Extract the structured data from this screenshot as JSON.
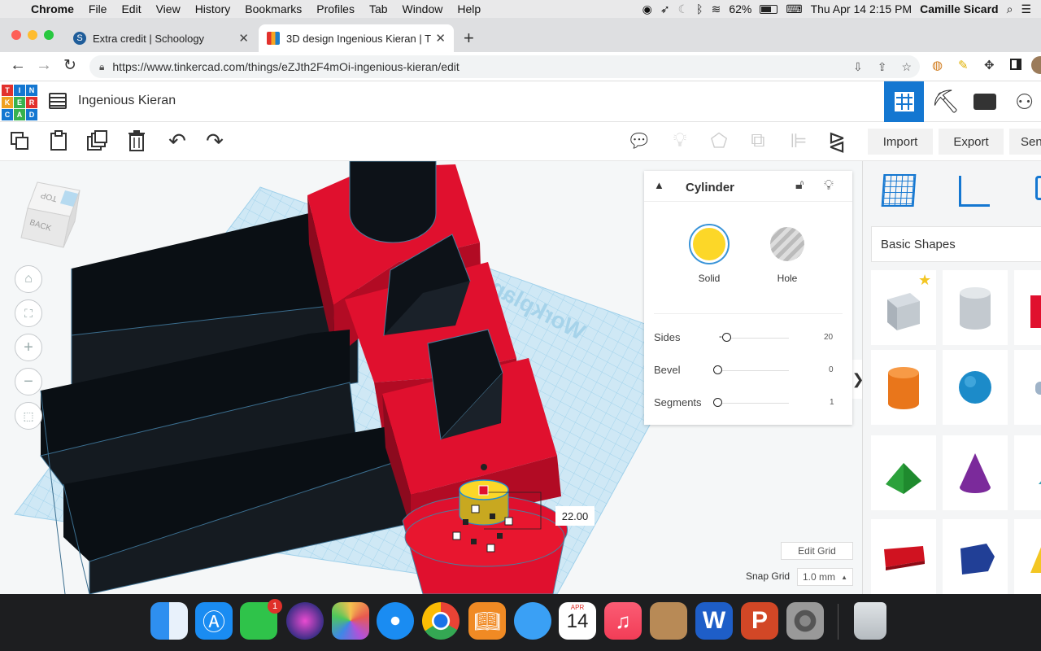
{
  "menubar": {
    "app": "Chrome",
    "items": [
      "File",
      "Edit",
      "View",
      "History",
      "Bookmarks",
      "Profiles",
      "Tab",
      "Window",
      "Help"
    ],
    "battery": "62%",
    "clock": "Thu Apr 14  2:15 PM",
    "user": "Camille Sicard"
  },
  "tabs": [
    {
      "title": "Extra credit | Schoology",
      "favicon": "S"
    },
    {
      "title": "3D design Ingenious Kieran | T",
      "favicon": "grid"
    }
  ],
  "url": "https://www.tinkercad.com/things/eZJth2F4mOi-ingenious-kieran/edit",
  "tinkercad": {
    "logo": [
      "T",
      "I",
      "N",
      "K",
      "E",
      "R",
      "C",
      "A",
      "D"
    ],
    "design_name": "Ingenious Kieran",
    "import_label": "Import",
    "export_label": "Export",
    "send_label": "Sen"
  },
  "viewcube": {
    "top": "TOP",
    "back": "BACK"
  },
  "inspector": {
    "title": "Cylinder",
    "solid_label": "Solid",
    "hole_label": "Hole",
    "params": [
      {
        "label": "Sides",
        "value": "20",
        "fraction": 0.12
      },
      {
        "label": "Bevel",
        "value": "0",
        "fraction": 0.0
      },
      {
        "label": "Segments",
        "value": "1",
        "fraction": 0.0
      }
    ]
  },
  "dimension_label": "22.00",
  "workplane_label": "Workplane",
  "edit_grid_label": "Edit Grid",
  "snap_grid_label": "Snap Grid",
  "snap_grid_value": "1.0 mm",
  "right_panel": {
    "category": "Basic Shapes"
  },
  "dock": {
    "facetime_badge": "1",
    "calendar_month": "APR",
    "calendar_day": "14"
  },
  "colors": {
    "red": "#e0102e",
    "blue": "#1477d1",
    "solid_yellow": "#fcd728"
  }
}
